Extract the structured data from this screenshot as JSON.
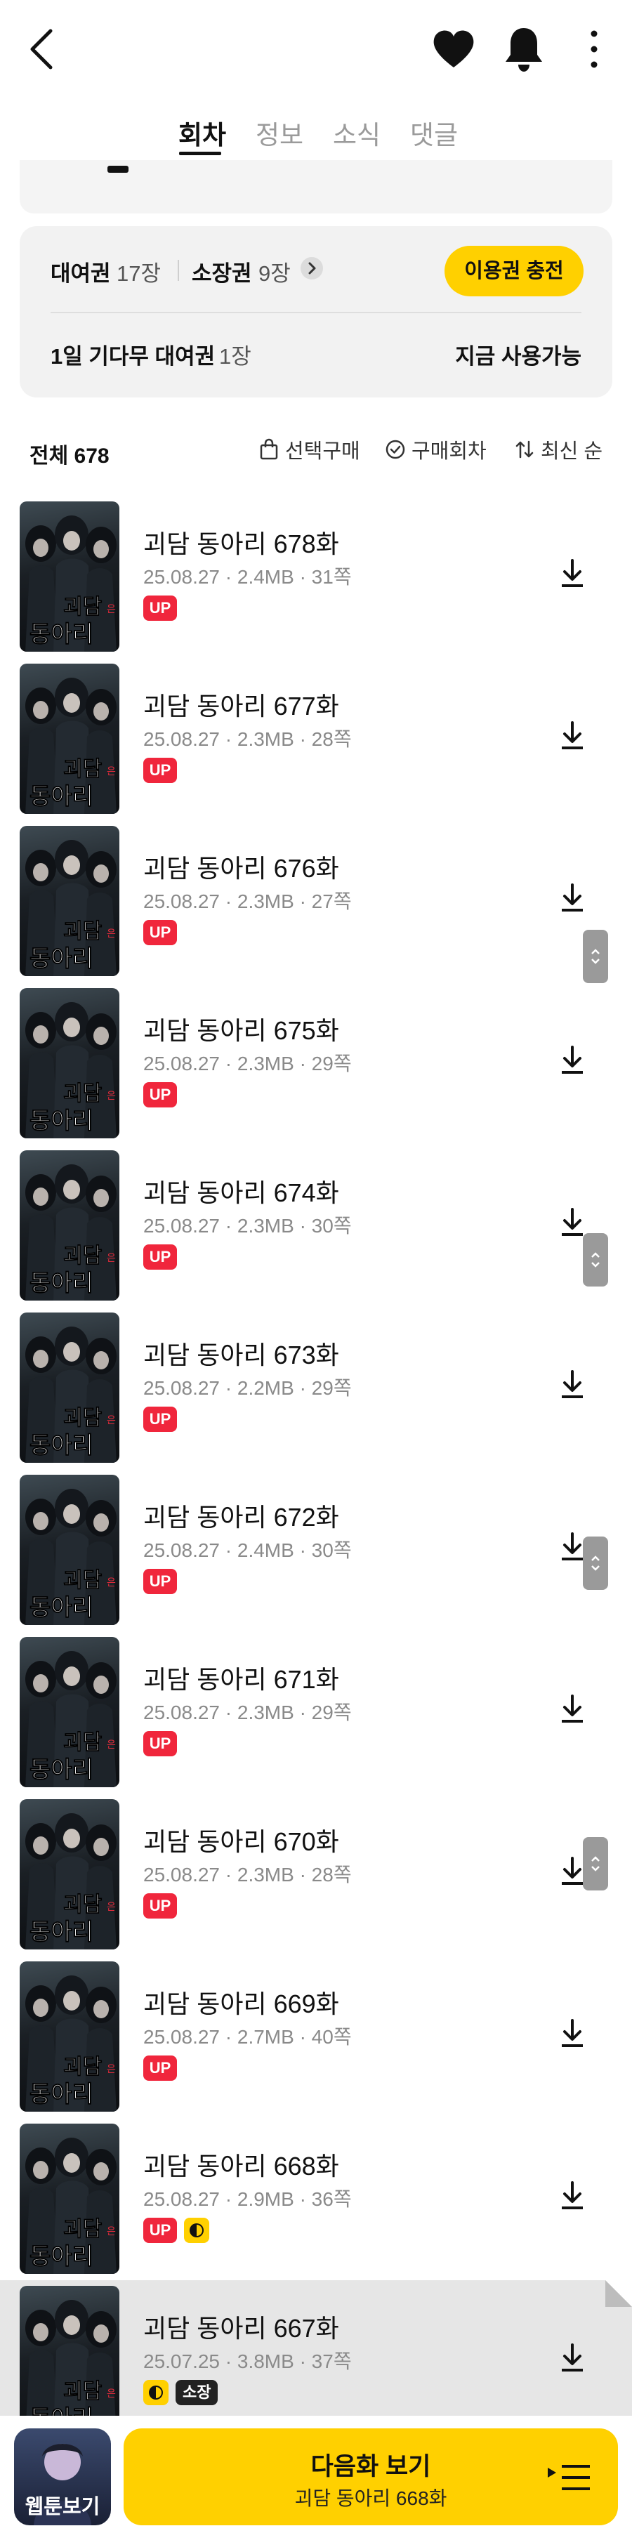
{
  "header": {
    "icons": [
      "chevron-left-icon",
      "heart-icon",
      "bell-icon",
      "more-vertical-icon"
    ]
  },
  "tabs": [
    {
      "label": "회차",
      "active": true
    },
    {
      "label": "정보",
      "active": false
    },
    {
      "label": "소식",
      "active": false
    },
    {
      "label": "댓글",
      "active": false
    }
  ],
  "tickets": {
    "rent_label": "대여권",
    "rent_count": "17장",
    "own_label": "소장권",
    "own_count": "9장",
    "charge_label": "이용권 충전",
    "wait_label": "1일 기다무 대여권",
    "wait_count": "1장",
    "wait_status": "지금 사용가능"
  },
  "list_header": {
    "total": "전체 678",
    "select_buy": "선택구매",
    "bought": "구매회차",
    "sort": "최신 순"
  },
  "episodes": [
    {
      "title": "괴담 동아리 678화",
      "meta": "25.08.27 · 2.4MB · 31쪽",
      "badges": [
        "UP"
      ]
    },
    {
      "title": "괴담 동아리 677화",
      "meta": "25.08.27 · 2.3MB · 28쪽",
      "badges": [
        "UP"
      ]
    },
    {
      "title": "괴담 동아리 676화",
      "meta": "25.08.27 · 2.3MB · 27쪽",
      "badges": [
        "UP"
      ]
    },
    {
      "title": "괴담 동아리 675화",
      "meta": "25.08.27 · 2.3MB · 29쪽",
      "badges": [
        "UP"
      ]
    },
    {
      "title": "괴담 동아리 674화",
      "meta": "25.08.27 · 2.3MB · 30쪽",
      "badges": [
        "UP"
      ]
    },
    {
      "title": "괴담 동아리 673화",
      "meta": "25.08.27 · 2.2MB · 29쪽",
      "badges": [
        "UP"
      ]
    },
    {
      "title": "괴담 동아리 672화",
      "meta": "25.08.27 · 2.4MB · 30쪽",
      "badges": [
        "UP"
      ]
    },
    {
      "title": "괴담 동아리 671화",
      "meta": "25.08.27 · 2.3MB · 29쪽",
      "badges": [
        "UP"
      ]
    },
    {
      "title": "괴담 동아리 670화",
      "meta": "25.08.27 · 2.3MB · 28쪽",
      "badges": [
        "UP"
      ]
    },
    {
      "title": "괴담 동아리 669화",
      "meta": "25.08.27 · 2.7MB · 40쪽",
      "badges": [
        "UP"
      ]
    },
    {
      "title": "괴담 동아리 668화",
      "meta": "25.08.27 · 2.9MB · 36쪽",
      "badges": [
        "UP",
        "wait"
      ]
    },
    {
      "title": "괴담 동아리 667화",
      "meta": "25.07.25 · 3.8MB · 37쪽",
      "badges": [
        "wait",
        "소장"
      ],
      "dimmed": true
    }
  ],
  "thumbnail_caption": {
    "line1": "괴담",
    "small": "은",
    "line2": "동아리"
  },
  "bottom_bar": {
    "webtoon_label": "웹툰보기",
    "next_title": "다음화 보기",
    "next_subtitle": "괴담 동아리 668화"
  },
  "colors": {
    "accent": "#ffd000",
    "up_badge": "#f0263c",
    "own_badge": "#222222"
  }
}
